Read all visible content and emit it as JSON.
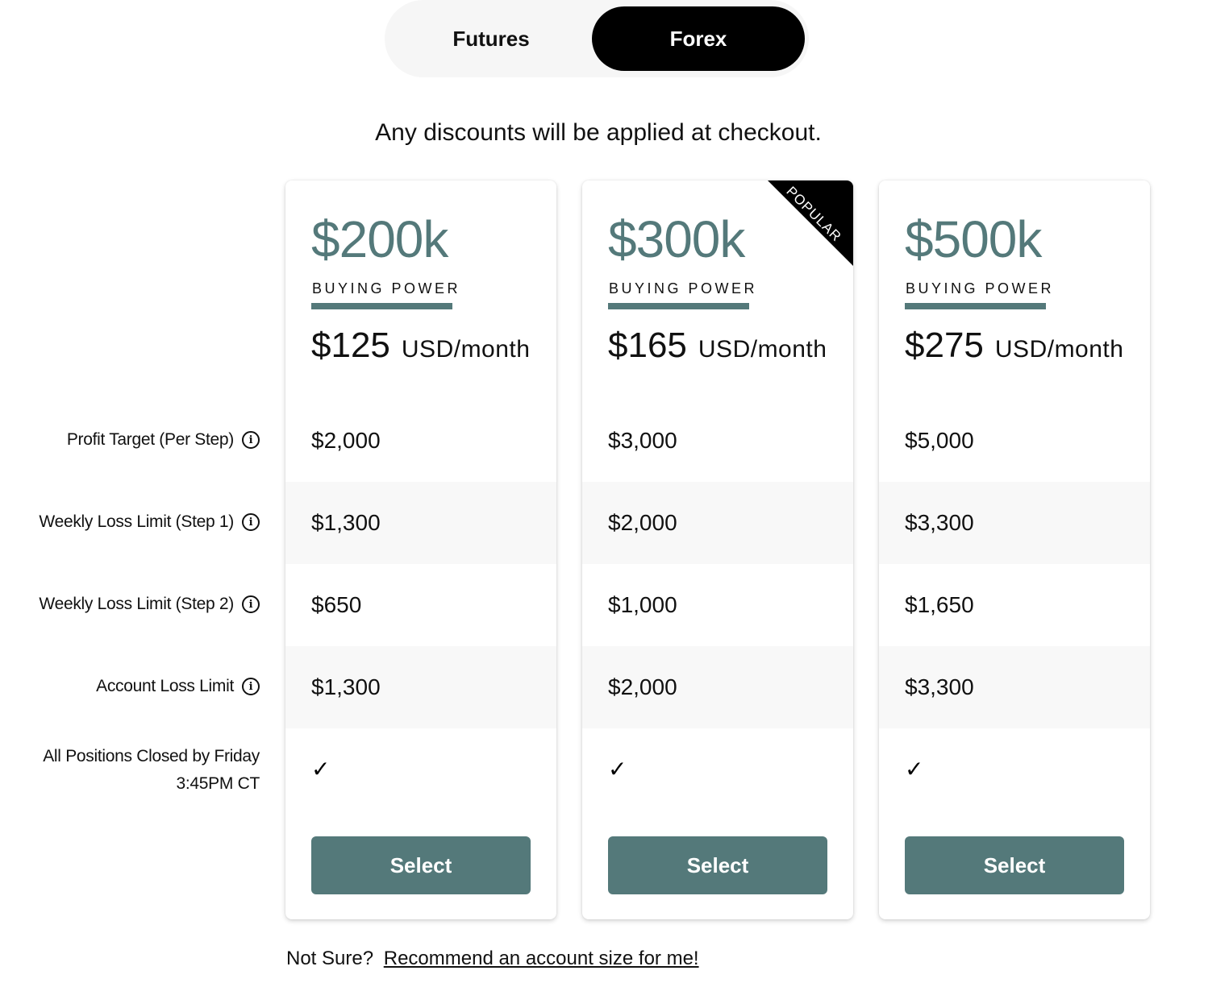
{
  "toggle": {
    "tabs": [
      {
        "label": "Futures",
        "active": false
      },
      {
        "label": "Forex",
        "active": true
      }
    ]
  },
  "discount_note": "Any discounts will be applied at checkout.",
  "row_labels": [
    {
      "label": "Profit Target (Per Step)",
      "icon": "info-icon"
    },
    {
      "label": "Weekly Loss Limit (Step 1)",
      "icon": "info-icon"
    },
    {
      "label": "Weekly Loss Limit (Step 2)",
      "icon": "info-icon"
    },
    {
      "label": "Account Loss Limit",
      "icon": "info-icon"
    },
    {
      "label_line1": "All Positions Closed by Friday",
      "label_line2": "3:45PM CT"
    }
  ],
  "plans": [
    {
      "size": "$200k",
      "buying_power_label": "BUYING POWER",
      "price": "$125",
      "price_unit": "USD/month",
      "profit_target": "$2,000",
      "weekly_loss_step1": "$1,300",
      "weekly_loss_step2": "$650",
      "account_loss_limit": "$1,300",
      "positions_closed": "✓",
      "select_label": "Select",
      "badge": null
    },
    {
      "size": "$300k",
      "buying_power_label": "BUYING POWER",
      "price": "$165",
      "price_unit": "USD/month",
      "profit_target": "$3,000",
      "weekly_loss_step1": "$2,000",
      "weekly_loss_step2": "$1,000",
      "account_loss_limit": "$2,000",
      "positions_closed": "✓",
      "select_label": "Select",
      "badge": "POPULAR"
    },
    {
      "size": "$500k",
      "buying_power_label": "BUYING POWER",
      "price": "$275",
      "price_unit": "USD/month",
      "profit_target": "$5,000",
      "weekly_loss_step1": "$3,300",
      "weekly_loss_step2": "$1,650",
      "account_loss_limit": "$3,300",
      "positions_closed": "✓",
      "select_label": "Select",
      "badge": null
    }
  ],
  "footer": {
    "prompt": "Not Sure?",
    "link": "Recommend an account size for me!"
  },
  "colors": {
    "accent": "#54797a",
    "active_tab": "#000000",
    "row_shade": "#f8f8f8"
  }
}
